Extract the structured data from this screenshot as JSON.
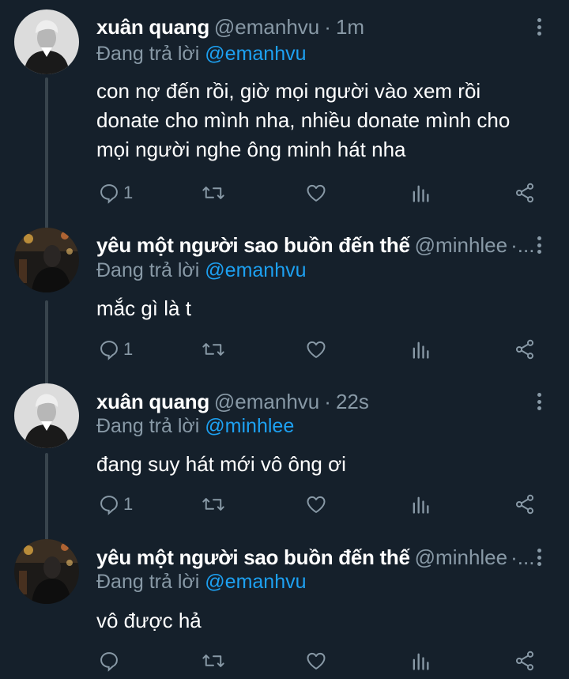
{
  "replying_prefix": "Đang trả lời",
  "tweets": [
    {
      "display_name": "xuân quang",
      "handle": "@emanhvu",
      "separator": "·",
      "time": "1m",
      "reply_to": "@emanhvu",
      "text_lines": [
        "con nợ đến rồi, giờ mọi người vào xem rồi",
        "donate cho mình nha, nhiều donate mình cho",
        "mọi người nghe ông minh hát nha"
      ],
      "reply_count": "1",
      "avatar": "portrait-black-white"
    },
    {
      "display_name": "yêu một người sao buồn đến thế",
      "handle": "@minhlee",
      "truncation": "·...",
      "reply_to": "@emanhvu",
      "text_lines": [
        "mắc gì là t"
      ],
      "reply_count": "1",
      "avatar": "dark-portrait-warm-lights"
    },
    {
      "display_name": "xuân quang",
      "handle": "@emanhvu",
      "separator": "·",
      "time": "22s",
      "reply_to": "@minhlee",
      "text_lines": [
        "đang suy hát mới vô ông ơi"
      ],
      "reply_count": "1",
      "avatar": "portrait-black-white"
    },
    {
      "display_name": "yêu một người sao buồn đến thế",
      "handle": "@minhlee",
      "truncation": "·...",
      "reply_to": "@emanhvu",
      "text_lines": [
        "vô được hả"
      ],
      "reply_count": "",
      "avatar": "dark-portrait-warm-lights"
    }
  ],
  "icons": [
    "reply-icon",
    "retweet-icon",
    "like-icon",
    "analytics-icon",
    "share-icon",
    "more-options-icon"
  ],
  "colors": {
    "background": "#15202b",
    "text_primary": "#ffffff",
    "text_secondary": "#8899a6",
    "mention": "#1da1f2",
    "thread_line": "#38444d"
  }
}
